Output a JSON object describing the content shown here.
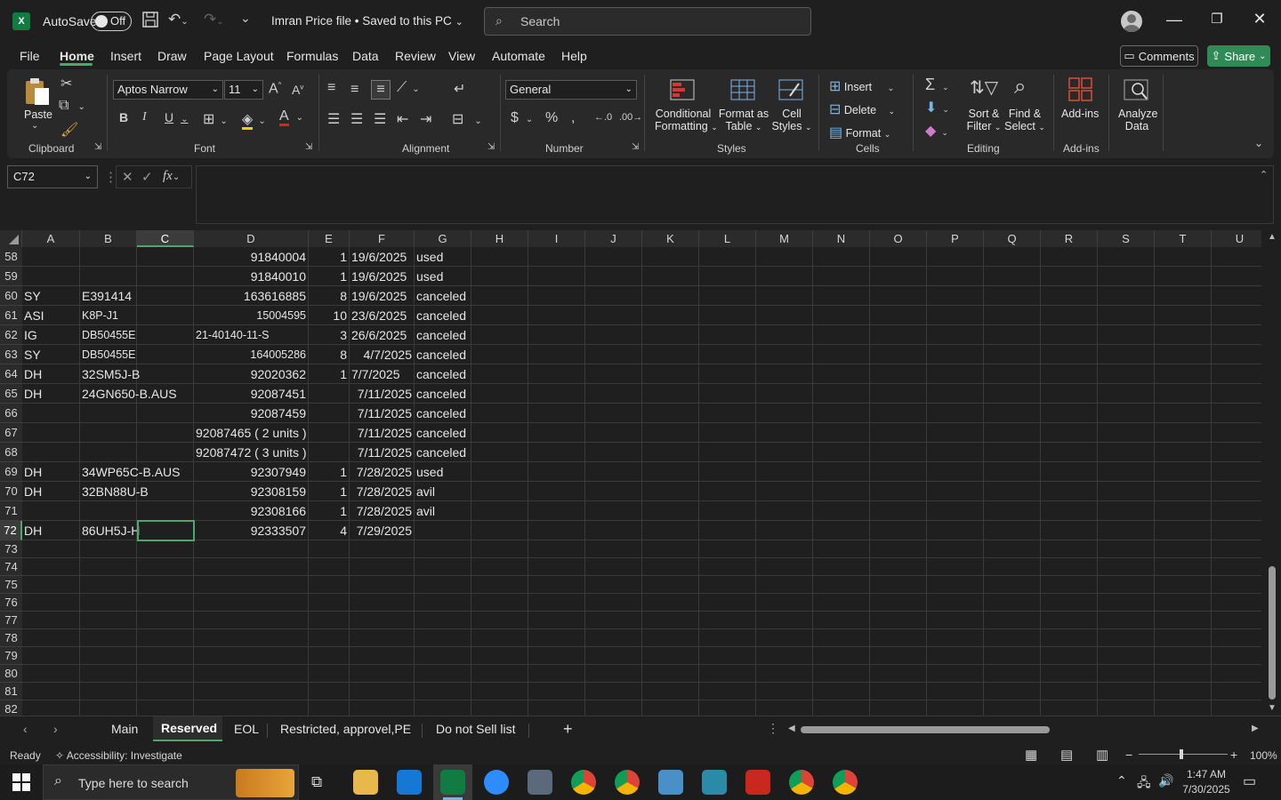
{
  "window": {
    "autosave_label": "AutoSave",
    "autosave_state": "Off",
    "title": "Imran Price file • Saved to this PC",
    "search_placeholder": "Search"
  },
  "menu": {
    "tabs": [
      "File",
      "Home",
      "Insert",
      "Draw",
      "Page Layout",
      "Formulas",
      "Data",
      "Review",
      "View",
      "Automate",
      "Help"
    ],
    "active": "Home",
    "comments_label": "Comments",
    "share_label": "Share"
  },
  "ribbon": {
    "clipboard": {
      "paste": "Paste",
      "group": "Clipboard"
    },
    "font": {
      "family": "Aptos Narrow",
      "size": "11",
      "group": "Font"
    },
    "alignment": {
      "group": "Alignment"
    },
    "number": {
      "format": "General",
      "group": "Number"
    },
    "styles": {
      "conditional_1": "Conditional",
      "conditional_2": "Formatting",
      "format_table_1": "Format as",
      "format_table_2": "Table",
      "cell_styles_1": "Cell",
      "cell_styles_2": "Styles",
      "group": "Styles"
    },
    "cells": {
      "insert": "Insert",
      "delete": "Delete",
      "format": "Format",
      "group": "Cells"
    },
    "editing": {
      "sort_1": "Sort &",
      "sort_2": "Filter",
      "find_1": "Find &",
      "find_2": "Select",
      "group": "Editing"
    },
    "addins": {
      "addins": "Add-ins",
      "group": "Add-ins",
      "analyze_1": "Analyze",
      "analyze_2": "Data"
    }
  },
  "namebox": "C72",
  "columns": [
    "A",
    "B",
    "C",
    "D",
    "E",
    "F",
    "G",
    "H",
    "I",
    "J",
    "K",
    "L",
    "M",
    "N",
    "O",
    "P",
    "Q",
    "R",
    "S",
    "T",
    "U"
  ],
  "selected_column": "C",
  "rows": [
    {
      "n": "58",
      "A": "",
      "B": "",
      "C": "",
      "D": "91840004",
      "E": "1",
      "F": "19/6/2025",
      "G": "used"
    },
    {
      "n": "59",
      "A": "",
      "B": "",
      "C": "",
      "D": "91840010",
      "E": "1",
      "F": "19/6/2025",
      "G": "used"
    },
    {
      "n": "60",
      "A": "SY",
      "B": "E391414",
      "C": "",
      "D": "163616885",
      "E": "8",
      "F": "19/6/2025",
      "G": "canceled"
    },
    {
      "n": "61",
      "A": "ASI",
      "B": "K8P-J1",
      "C": "",
      "D": "15004595",
      "E": "10",
      "F": "23/6/2025",
      "G": "canceled"
    },
    {
      "n": "62",
      "A": "IG",
      "B": "DB50455E",
      "C": "",
      "D": "21-40140-11-S",
      "E": "3",
      "F": "26/6/2025",
      "G": "canceled"
    },
    {
      "n": "63",
      "A": "SY",
      "B": "DB50455E",
      "C": "",
      "D": "164005286",
      "E": "8",
      "F": "4/7/2025",
      "G": "canceled"
    },
    {
      "n": "64",
      "A": "DH",
      "B": "32SM5J-B",
      "C": "",
      "D": "92020362",
      "E": "1",
      "F": "7/7/2025",
      "G": "canceled"
    },
    {
      "n": "65",
      "A": "DH",
      "B": "24GN650-B.AUS",
      "C": "",
      "D": "92087451",
      "E": "",
      "F": "7/11/2025",
      "G": "canceled"
    },
    {
      "n": "66",
      "A": "",
      "B": "",
      "C": "",
      "D": "92087459",
      "E": "",
      "F": "7/11/2025",
      "G": "canceled"
    },
    {
      "n": "67",
      "A": "",
      "B": "",
      "C": "",
      "D": "92087465 ( 2 units )",
      "E": "",
      "F": "7/11/2025",
      "G": "canceled"
    },
    {
      "n": "68",
      "A": "",
      "B": "",
      "C": "",
      "D": "92087472 ( 3 units )",
      "E": "",
      "F": "7/11/2025",
      "G": "canceled"
    },
    {
      "n": "69",
      "A": "DH",
      "B": "34WP65C-B.AUS",
      "C": "",
      "D": "92307949",
      "E": "1",
      "F": "7/28/2025",
      "G": "used"
    },
    {
      "n": "70",
      "A": "DH",
      "B": "32BN88U-B",
      "C": "",
      "D": "92308159",
      "E": "1",
      "F": "7/28/2025",
      "G": "avil"
    },
    {
      "n": "71",
      "A": "",
      "B": "",
      "C": "",
      "D": "92308166",
      "E": "1",
      "F": "7/28/2025",
      "G": "avil"
    },
    {
      "n": "72",
      "A": "DH",
      "B": "86UH5J-H",
      "C": "",
      "D": "92333507",
      "E": "4",
      "F": "7/29/2025",
      "G": ""
    },
    {
      "n": "73"
    },
    {
      "n": "74"
    },
    {
      "n": "75"
    },
    {
      "n": "76"
    },
    {
      "n": "77"
    },
    {
      "n": "78"
    },
    {
      "n": "79"
    },
    {
      "n": "80"
    },
    {
      "n": "81"
    },
    {
      "n": "82"
    }
  ],
  "sheets": [
    "Main",
    "Reserved",
    "EOL",
    "Restricted, approvel,PE",
    "Do not Sell list"
  ],
  "active_sheet": "Reserved",
  "status": {
    "ready": "Ready",
    "accessibility": "Accessibility: Investigate",
    "zoom": "100%"
  },
  "taskbar": {
    "search_placeholder": "Type here to search",
    "time": "1:47 AM",
    "date": "7/30/2025"
  },
  "colors": {
    "accent": "#4ca86f",
    "excel_green": "#107c41",
    "share_green": "#2f8a55"
  }
}
